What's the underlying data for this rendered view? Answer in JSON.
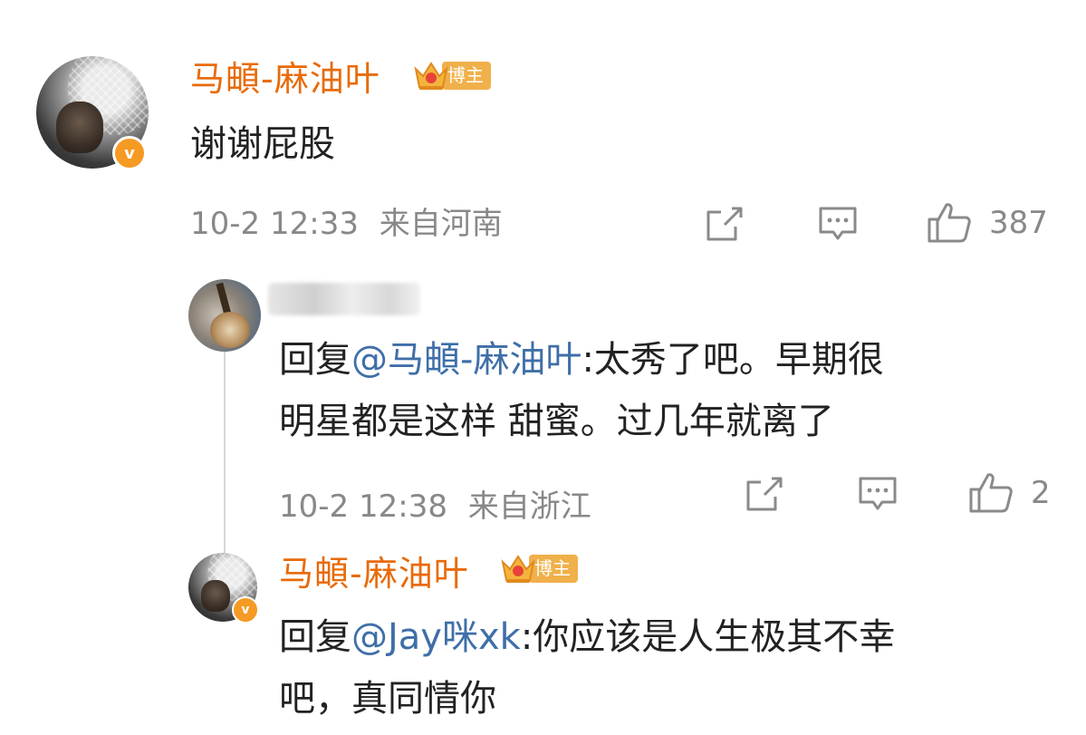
{
  "comments": [
    {
      "author": "马頔-麻油叶",
      "tag": "博主",
      "text": "谢谢屁股",
      "time": "10-2 12:33",
      "location": "来自河南",
      "likes": "387"
    },
    {
      "author": "",
      "reply_prefix": "回复",
      "mention": "@马頔-麻油叶",
      "text_line1": ":太秀了吧。早期很",
      "text_line2": "明星都是这样 甜蜜。过几年就离了",
      "time": "10-2 12:38",
      "location": "来自浙江",
      "likes": "2"
    },
    {
      "author": "马頔-麻油叶",
      "tag": "博主",
      "reply_prefix": "回复",
      "mention": "@Jay咪xk",
      "text_line1": ":你应该是人生极其不幸",
      "text_line2": "吧，真同情你"
    }
  ],
  "icons": {
    "share": "share-icon",
    "comment": "comment-icon",
    "like": "thumbs-up-icon",
    "verified": "verified-badge-icon",
    "crown": "crown-icon"
  },
  "colors": {
    "name": "#e86b0a",
    "mention": "#3f6fa8",
    "meta": "#888888",
    "verified": "#f59a23"
  }
}
